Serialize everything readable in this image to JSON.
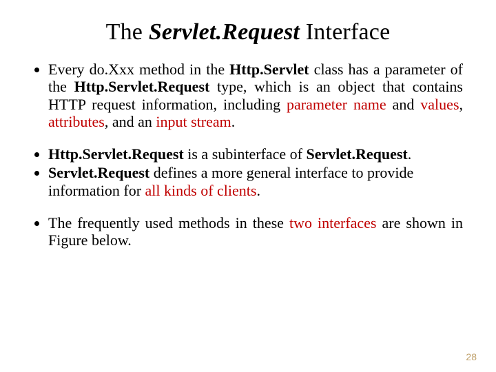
{
  "title": {
    "pre": "The ",
    "emph": "Servlet.Request",
    "post": " Interface"
  },
  "bullets": {
    "b1": {
      "t1": "Every do.Xxx method in the ",
      "bold1": "Http.Servlet",
      "t2": " class has a parameter of the ",
      "bold2": "Http.Servlet.Request",
      "t3": " type, which is an object that contains HTTP request information, including ",
      "h1": "parameter name",
      "t4": " and ",
      "h2": "values",
      "t5": ", ",
      "h3": "attributes",
      "t6": ", and an ",
      "h4": "input stream",
      "t7": "."
    },
    "b2": {
      "bold1": "Http.Servlet.Request",
      "t1": " is a subinterface of ",
      "bold2": "Servlet.Request",
      "t2": "."
    },
    "b3": {
      "bold1": "Servlet.Request",
      "t1": " defines a more general interface to provide information for ",
      "h1": "all kinds of clients",
      "t2": "."
    },
    "b4": {
      "t1": "The frequently used methods in these ",
      "h1": "two interfaces",
      "t2": " are shown in Figure below."
    }
  },
  "page_number": "28"
}
